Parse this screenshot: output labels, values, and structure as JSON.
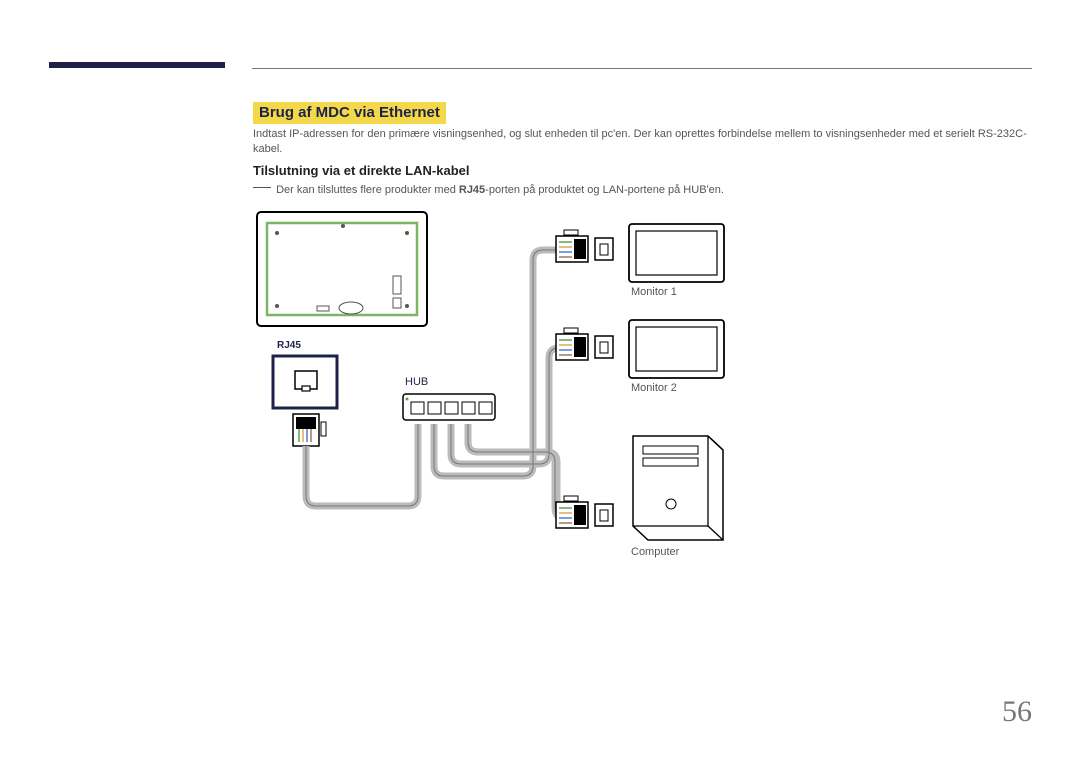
{
  "section_title": "Brug af MDC via Ethernet",
  "intro_text": "Indtast IP-adressen for den primære visningsenhed, og slut enheden til pc'en. Der kan oprettes forbindelse mellem to visningsenheder med et serielt RS-232C-kabel.",
  "sub_title": "Tilslutning via et direkte LAN-kabel",
  "note_prefix": "Der kan tilsluttes flere produkter med ",
  "note_bold": "RJ45",
  "note_suffix": "-porten på produktet og LAN-portene på HUB'en.",
  "diagram": {
    "rj45_label": "RJ45",
    "hub_label": "HUB",
    "monitor1_label": "Monitor 1",
    "monitor2_label": "Monitor 2",
    "computer_label": "Computer"
  },
  "page_number": "56"
}
